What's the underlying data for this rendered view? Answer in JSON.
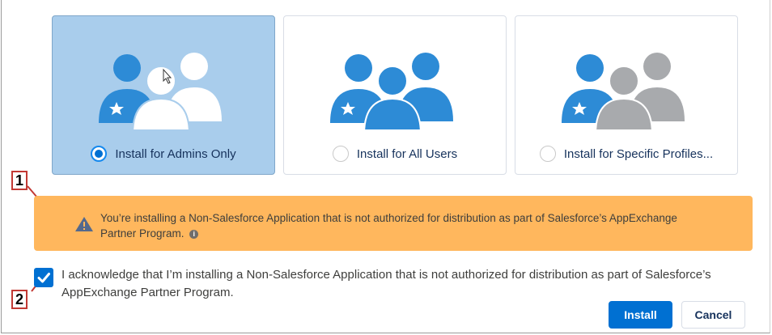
{
  "options": [
    {
      "label": "Install for Admins Only",
      "selected": true,
      "icon": "admins-group-icon"
    },
    {
      "label": "Install for All Users",
      "selected": false,
      "icon": "all-users-group-icon"
    },
    {
      "label": "Install for Specific Profiles...",
      "selected": false,
      "icon": "specific-profiles-group-icon"
    }
  ],
  "alert": {
    "message": "You’re installing a Non-Salesforce Application that is not authorized for distribution as part of Salesforce’s AppExchange Partner Program.",
    "info_icon": "i"
  },
  "acknowledge": {
    "checked": true,
    "text": "I acknowledge that I’m installing a Non-Salesforce Application that is not authorized for distribution as part of Salesforce’s AppExchange Partner Program."
  },
  "callouts": {
    "first": "1",
    "second": "2"
  },
  "buttons": {
    "install": "Install",
    "cancel": "Cancel"
  },
  "colors": {
    "brand": "#0070d2",
    "selected_card": "#a9cdec",
    "warning": "#ffb75d",
    "user_blue": "#2d8bd6",
    "user_gray": "#a8aaad",
    "callout_red": "#c23934"
  }
}
